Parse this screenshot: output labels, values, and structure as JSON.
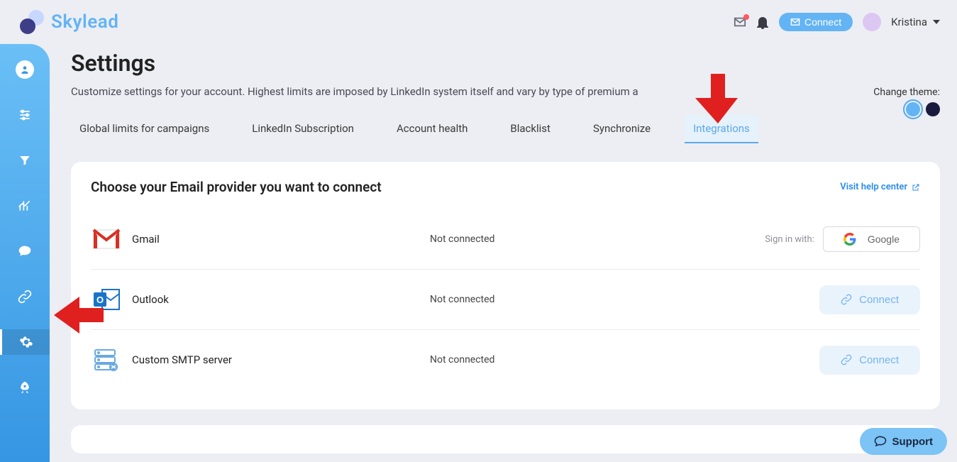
{
  "brand": "Skylead",
  "header": {
    "connect_label": "Connect",
    "username": "Kristina"
  },
  "page": {
    "title": "Settings",
    "description": "Customize settings for your account. Highest limits are imposed by LinkedIn system itself and vary by type of premium a"
  },
  "theme": {
    "label": "Change theme:"
  },
  "tabs": [
    {
      "label": "Global limits for campaigns",
      "active": false
    },
    {
      "label": "LinkedIn Subscription",
      "active": false
    },
    {
      "label": "Account health",
      "active": false
    },
    {
      "label": "Blacklist",
      "active": false
    },
    {
      "label": "Synchronize",
      "active": false
    },
    {
      "label": "Integrations",
      "active": true
    }
  ],
  "card": {
    "title": "Choose your Email provider you want to connect",
    "help_link": "Visit help center"
  },
  "providers": {
    "gmail": {
      "name": "Gmail",
      "status": "Not connected",
      "signin_label": "Sign in with:",
      "button": "Google"
    },
    "outlook": {
      "name": "Outlook",
      "status": "Not connected",
      "button": "Connect"
    },
    "smtp": {
      "name": "Custom SMTP server",
      "status": "Not connected",
      "button": "Connect"
    }
  },
  "support": {
    "label": "Support"
  }
}
